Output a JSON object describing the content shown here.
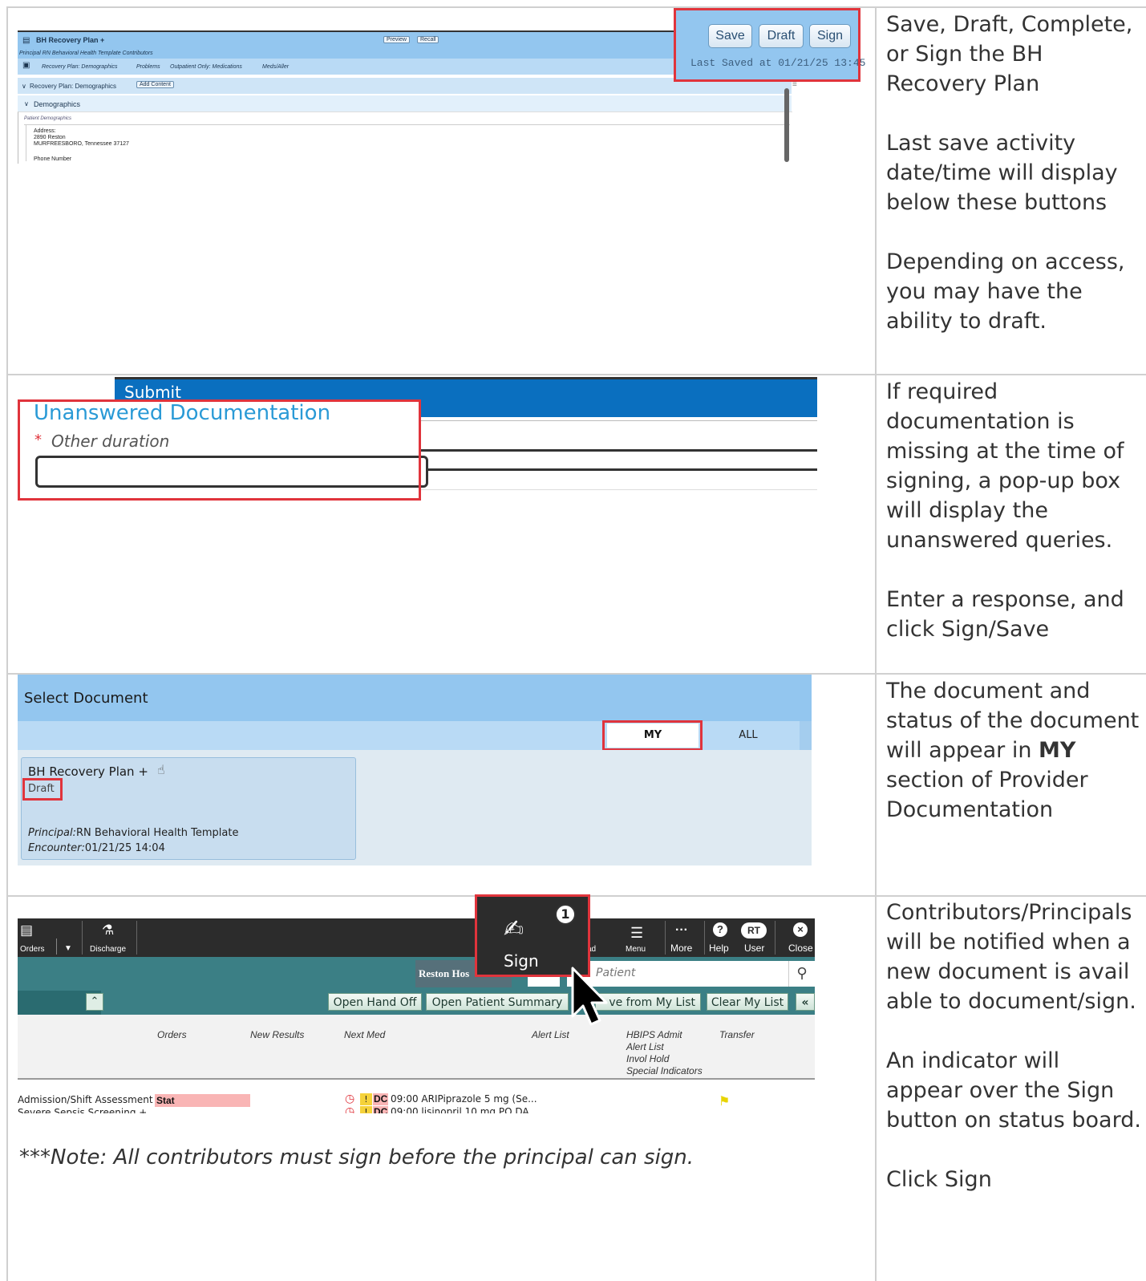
{
  "row1": {
    "ehr": {
      "title": "BH Recovery Plan +",
      "subtitle": "Principal RN Behavioral Health Template Contributors",
      "preview": "Preview",
      "recall": "Recall",
      "tabs": [
        "Recovery Plan: Demographics",
        "Problems",
        "Outpatient Only: Medications",
        "Meds/Aller"
      ],
      "section": "Recovery Plan: Demographics",
      "add_content": "Add Content",
      "demographics": "Demographics",
      "patient_demo": "Patient Demographics",
      "address_label": "Address:",
      "address_line1": "2890 Reston",
      "address_line2": "MURFREESBORO, Tennessee 37127",
      "phone": "Phone Number",
      "save": "Save",
      "draft": "Draft",
      "sign": "Sign",
      "last_saved": "Last Saved at 01/21/25 13:45"
    },
    "desc": [
      "Save, Draft, Complete, or Sign the BH Recovery Plan",
      "Last save activity date/time will display below these buttons",
      "Depending on access, you may have the ability to draft."
    ]
  },
  "row2": {
    "submit": "Submit",
    "unanswered": "Unanswered Documentation",
    "required_mark": "*",
    "other_duration": "Other duration",
    "desc": [
      "If required documentation is missing at the time of signing, a pop-up box will display the unanswered queries.",
      "Enter a response, and click Sign/Save"
    ]
  },
  "row3": {
    "select_document": "Select Document",
    "my": "MY",
    "all": "ALL",
    "doc_title": "BH Recovery Plan +",
    "doc_status": "Draft",
    "principal_label": "Principal:",
    "principal_value": "RN Behavioral Health Template",
    "encounter_label": "Encounter:",
    "encounter_value": "01/21/25 14:04",
    "desc_pre": "The document and status of the document will appear in ",
    "desc_bold": "MY",
    "desc_post": " section of Provider Documentation"
  },
  "row4": {
    "toolbar": {
      "orders": "Orders",
      "discharge": "Discharge",
      "sign": "Sign",
      "sign_badge": "1",
      "ad": "ad",
      "menu": "Menu",
      "more": "More",
      "help": "Help",
      "user_initials": "RT",
      "user": "User",
      "close": "Close"
    },
    "hospital": "Reston Hos",
    "patient_placeholder": "Patient",
    "open_hand_off": "Open Hand Off",
    "open_patient_summary": "Open Patient Summary",
    "remove_from_list": "ve from My List",
    "clear_my_list": "Clear My List",
    "headers": {
      "orders": "Orders",
      "new_results": "New Results",
      "next_med": "Next Med",
      "alert_list": "Alert List",
      "hbips1": "HBIPS Admit",
      "hbips2": "Alert List",
      "hbips3": "Invol Hold",
      "hbips4": "Special Indicators",
      "transfer": "Transfer"
    },
    "row_order": "Admission/Shift Assessment +",
    "row_order2": "Severe Sepsis Screening +",
    "stat": "Stat",
    "dc": "DC",
    "med1": "09:00 ARIPiprazole 5 mg (Se...",
    "med2": "09:00 lisinopril 10 mg PO DA",
    "note": "***Note: All contributors must sign before the principal can sign.",
    "desc": [
      "Contributors/Principals will be notified when a new document is available to document/sign.",
      "An indicator will appear over the Sign button on status board.",
      "Click Sign"
    ]
  },
  "colors": {
    "header_blue": "#93c6ef",
    "sub_blue": "#b9daf5",
    "highlight_red": "#e0343c",
    "link_blue": "#2a9ad6",
    "teal": "#3b7f85",
    "submit_blue": "#0a6fbf"
  }
}
